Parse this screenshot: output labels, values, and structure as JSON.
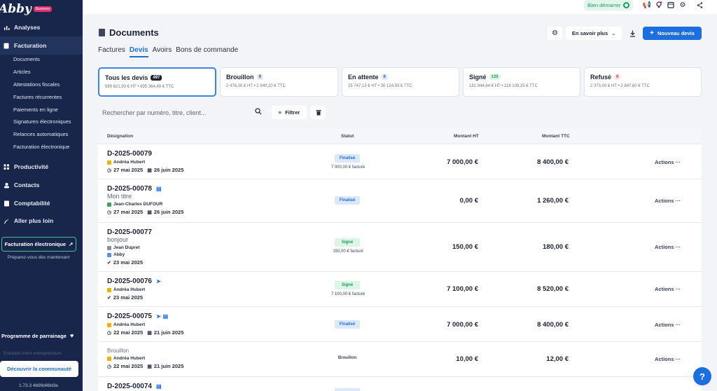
{
  "brand": {
    "name": "Abby",
    "badge": "Business"
  },
  "sidebar": {
    "items": [
      {
        "label": "Analyses"
      },
      {
        "label": "Facturation"
      },
      {
        "label": "Productivité"
      },
      {
        "label": "Contacts"
      },
      {
        "label": "Comptabilité"
      },
      {
        "label": "Aller plus loin"
      }
    ],
    "sub_items": [
      "Documents",
      "Articles",
      "Attestations fiscales",
      "Factures récurrentes",
      "Paiements en ligne",
      "Signatures électroniques",
      "Relances automatiques",
      "Facturation électronique"
    ],
    "ef_card": "Facturation électronique",
    "ef_sub": "Préparez-vous dès maintenant",
    "parrainage": "Programme de parrainage",
    "entraide": "Entraide entre entrepreneurs",
    "community": "Découvrir la communauté",
    "version": "1.73.3 4b99d48d3e"
  },
  "topbar": {
    "start_label": "Bien démarrer"
  },
  "header": {
    "title": "Documents",
    "learn_more": "En savoir plus",
    "new_quote": "Nouveau devis"
  },
  "tabs": [
    "Factures",
    "Devis",
    "Avoirs",
    "Bons de commande"
  ],
  "cards": [
    {
      "title": "Tous les devis",
      "count": "497",
      "sub": "589 621,93 € HT • 695 364,49 € TTC"
    },
    {
      "title": "Brouillon",
      "count": "9",
      "sub": "2 476,00 € HT • 2 940,20 € TTC"
    },
    {
      "title": "En attente",
      "count": "8",
      "sub": "25 747,13 € HT • 30 124,53 € TTC"
    },
    {
      "title": "Signé",
      "count": "120",
      "sub": "181 944,64 € HT • 119 109,25 € TTC"
    },
    {
      "title": "Refusé",
      "count": "6",
      "sub": "2 373,00 € HT • 2 847,60 € TTC"
    }
  ],
  "search": {
    "placeholder": "Rechercher par numéro, titre, client..."
  },
  "filter_label": "Filtrer",
  "table": {
    "headers": {
      "designation": "Désignation",
      "status": "Statut",
      "ht": "Montant HT",
      "ttc": "Montant TTC"
    },
    "actions_label": "Actions ···",
    "rows": [
      {
        "number": "D-2025-00079",
        "title": "",
        "client": "Andréa Hubert",
        "client2": "",
        "date1": "27 mai 2025",
        "date2": "26 juin 2025",
        "status": "Finalisé",
        "billed": "7 000,00 € facturé",
        "ht": "7 000,00 €",
        "ttc": "8 400,00 €"
      },
      {
        "number": "D-2025-00078",
        "title": "Mon titre",
        "client": "Jean-Charles DUFOUR",
        "client2": "",
        "date1": "27 mai 2025",
        "date2": "26 juin 2025",
        "status": "Finalisé",
        "billed": "",
        "ht": "0,00 €",
        "ttc": "1 260,00 €"
      },
      {
        "number": "D-2025-00077",
        "title": "bonjour",
        "client": "Jean Dupret",
        "client2": "Abby",
        "date1": "23 mai 2025",
        "date2": "",
        "status": "Signé",
        "billed": "150,00 € facturé",
        "ht": "150,00 €",
        "ttc": "180,00 €"
      },
      {
        "number": "D-2025-00076",
        "title": "",
        "client": "Andréa Hubert",
        "client2": "",
        "date1": "23 mai 2025",
        "date2": "",
        "status": "Signé",
        "billed": "7 100,00 € facturé",
        "ht": "7 100,00 €",
        "ttc": "8 520,00 €"
      },
      {
        "number": "D-2025-00075",
        "title": "",
        "client": "Andréa Hubert",
        "client2": "",
        "date1": "22 mai 2025",
        "date2": "21 juin 2025",
        "status": "Finalisé",
        "billed": "",
        "ht": "7 000,00 €",
        "ttc": "8 400,00 €"
      },
      {
        "number": "Brouillon",
        "title": "",
        "client": "Andréa Hubert",
        "client2": "",
        "date1": "22 mai 2025",
        "date2": "21 juin 2025",
        "status": "Brouillon",
        "billed": "",
        "ht": "10,00 €",
        "ttc": "12,00 €"
      },
      {
        "number": "D-2025-00074",
        "title": "",
        "client": "",
        "client2": "",
        "date1": "",
        "date2": "",
        "status": "",
        "billed": "",
        "ht": "",
        "ttc": ""
      }
    ]
  },
  "help": "?"
}
